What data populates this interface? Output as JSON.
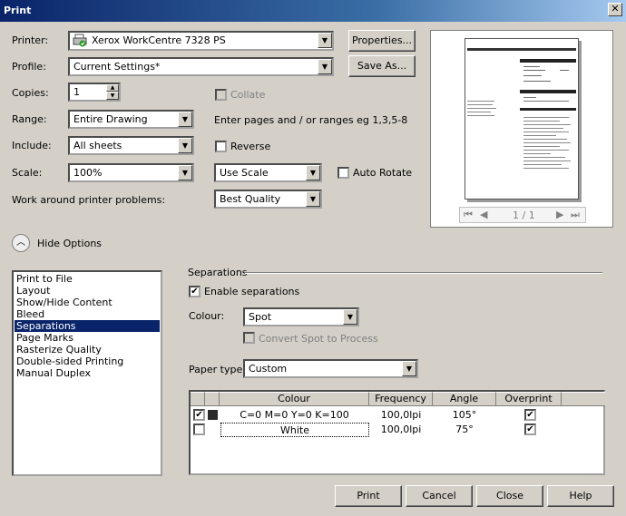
{
  "window": {
    "title": "Print",
    "close_glyph": "✕"
  },
  "printer": {
    "label": "Printer:",
    "value": "Xerox WorkCentre 7328 PS",
    "icon": "printer-icon"
  },
  "properties_button": "Properties...",
  "profile": {
    "label": "Profile:",
    "value": "Current Settings*"
  },
  "save_as_button": "Save As...",
  "copies": {
    "label": "Copies:",
    "value": "1"
  },
  "collate": {
    "label": "Collate",
    "checked": false,
    "enabled": false
  },
  "range": {
    "label": "Range:",
    "value": "Entire Drawing"
  },
  "range_hint": "Enter pages and / or ranges eg 1,3,5-8",
  "include": {
    "label": "Include:",
    "value": "All sheets"
  },
  "reverse": {
    "label": "Reverse",
    "checked": false
  },
  "scale": {
    "label": "Scale:",
    "value": "100%"
  },
  "scale_mode": {
    "value": "Use Scale"
  },
  "auto_rotate": {
    "label": "Auto Rotate",
    "checked": false
  },
  "workaround": {
    "label": "Work around printer problems:",
    "value": "Best Quality"
  },
  "preview_nav": {
    "page_indicator": "1 / 1"
  },
  "hide_options": "Hide Options",
  "options_list": [
    "Print to File",
    "Layout",
    "Show/Hide Content",
    "Bleed",
    "Separations",
    "Page Marks",
    "Rasterize Quality",
    "Double-sided Printing",
    "Manual Duplex"
  ],
  "selected_option_index": 4,
  "separations": {
    "group_title": "Separations",
    "enable": {
      "label": "Enable separations",
      "checked": true
    },
    "colour": {
      "label": "Colour:",
      "value": "Spot"
    },
    "convert_spot": {
      "label": "Convert Spot to Process",
      "checked": false,
      "enabled": false
    },
    "paper_type": {
      "label": "Paper type:",
      "value": "Custom"
    },
    "table": {
      "headers": [
        "Colour",
        "Frequency",
        "Angle",
        "Overprint"
      ],
      "rows": [
        {
          "enabled": true,
          "swatch": "#2b2b2b",
          "colour": "C=0 M=0 Y=0 K=100",
          "frequency": "100,0lpi",
          "angle": "105°",
          "overprint": true
        },
        {
          "enabled": false,
          "swatch": "#ffffff",
          "colour": "White",
          "frequency": "100,0lpi",
          "angle": "75°",
          "overprint": true
        }
      ]
    }
  },
  "footer": {
    "print": "Print",
    "cancel": "Cancel",
    "close": "Close",
    "help": "Help"
  }
}
